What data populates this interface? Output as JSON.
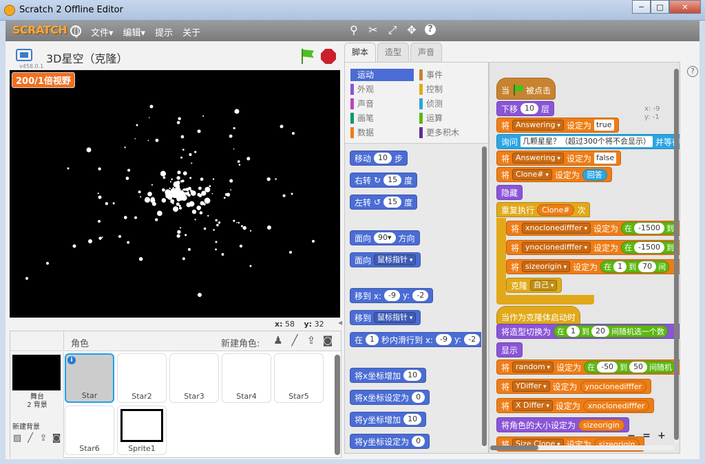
{
  "window": {
    "title": "Scratch 2 Offline Editor",
    "minimize": "─",
    "maximize": "□",
    "close": "✕"
  },
  "menubar": {
    "logo": "SCRATCH",
    "menus": [
      "文件▾",
      "编辑▾",
      "提示",
      "关于"
    ],
    "tools": [
      "duplicate-icon",
      "delete-icon",
      "grow-icon",
      "shrink-icon",
      "help-icon"
    ],
    "help_label": "?"
  },
  "stage": {
    "project_title": "3D星空（克隆）",
    "version": "v458.0.1",
    "monitor": "200/1倍视野",
    "mouse_x_label": "x:",
    "mouse_x": "58",
    "mouse_y_label": "y:",
    "mouse_y": "32",
    "star_color": "#ffffff"
  },
  "sprites": {
    "header_label": "角色",
    "new_sprite_label": "新建角色:",
    "stage_thumb_label": "舞台",
    "stage_backdrops": "2 背景",
    "new_backdrop_label": "新建背景",
    "items": [
      "Star",
      "Star2",
      "Star3",
      "Star4",
      "Star5",
      "Star6",
      "Sprite1"
    ],
    "info_badge": "i"
  },
  "tabs": [
    "脚本",
    "造型",
    "声音"
  ],
  "categories": [
    {
      "label": "运动",
      "color": "#4a6cd4"
    },
    {
      "label": "事件",
      "color": "#c88330"
    },
    {
      "label": "外观",
      "color": "#8a55d7"
    },
    {
      "label": "控制",
      "color": "#e1a91a"
    },
    {
      "label": "声音",
      "color": "#bb42c3"
    },
    {
      "label": "侦测",
      "color": "#2ca5e2"
    },
    {
      "label": "画笔",
      "color": "#0e9a6c"
    },
    {
      "label": "运算",
      "color": "#5cb712"
    },
    {
      "label": "数据",
      "color": "#ee7d16"
    },
    {
      "label": "更多积木",
      "color": "#632d99"
    }
  ],
  "palette": {
    "move": [
      "移动",
      "10",
      "步"
    ],
    "turn_right": [
      "右转",
      "↻",
      "15",
      "度"
    ],
    "turn_left": [
      "左转",
      "↺",
      "15",
      "度"
    ],
    "point_dir": [
      "面向",
      "90▾",
      "方向"
    ],
    "point_towards": [
      "面向",
      "鼠标指针"
    ],
    "goto_xy": [
      "移到 x:",
      "-9",
      "y:",
      "-2"
    ],
    "goto": [
      "移到",
      "鼠标指针"
    ],
    "glide": [
      "在",
      "1",
      "秒内滑行到 x:",
      "-9",
      "y:",
      "-2"
    ],
    "change_x": [
      "将x坐标增加",
      "10"
    ],
    "set_x": [
      "将x坐标设定为",
      "0"
    ],
    "change_y": [
      "将y坐标增加",
      "10"
    ],
    "set_y": [
      "将y坐标设定为",
      "0"
    ]
  },
  "scripts": {
    "sprite_x": "x: -9",
    "sprite_y": "y: -1",
    "when_flag": [
      "当",
      "被点击"
    ],
    "go_back": [
      "下移",
      "10",
      "层"
    ],
    "set_answering_true": [
      "将",
      "Answering",
      "设定为",
      "true"
    ],
    "ask": [
      "询问",
      "几颗星星？（超过300个将不会显示）",
      "并等待"
    ],
    "set_answering_false": [
      "将",
      "Answering",
      "设定为",
      "false"
    ],
    "set_clone": [
      "将",
      "Clone#",
      "设定为",
      "回答"
    ],
    "hide": "隐藏",
    "repeat": [
      "重复执行",
      "Clone#",
      "次"
    ],
    "set_xno": [
      "将",
      "xnoclonedifffer",
      "设定为",
      "在",
      "-1500",
      "到"
    ],
    "set_yno": [
      "将",
      "ynoclonedifffer",
      "设定为",
      "在",
      "-1500",
      "到"
    ],
    "set_size": [
      "将",
      "sizeorigin",
      "设定为",
      "在",
      "1",
      "到",
      "70",
      "间"
    ],
    "clone": [
      "克隆",
      "自己"
    ],
    "when_clone": "当作为克隆体启动时",
    "switch_costume": [
      "将造型切换为",
      "在",
      "1",
      "到",
      "20",
      "间随机选一个数"
    ],
    "show": "显示",
    "set_random": [
      "将",
      "random",
      "设定为",
      "在",
      "-50",
      "到",
      "50",
      "间随机"
    ],
    "set_ydiffer": [
      "将",
      "YDiffer",
      "设定为",
      "ynoclonedifffer"
    ],
    "set_xdiffer": [
      "将",
      "X Differ",
      "设定为",
      "xnoclonedifffer"
    ],
    "set_size2": [
      "将角色的大小设定为",
      "sizeorigin"
    ],
    "set_sizeclone": [
      "将",
      "Size Clone",
      "设定为",
      "sizeorigin"
    ]
  },
  "zoom": [
    "−",
    "=",
    "+"
  ]
}
